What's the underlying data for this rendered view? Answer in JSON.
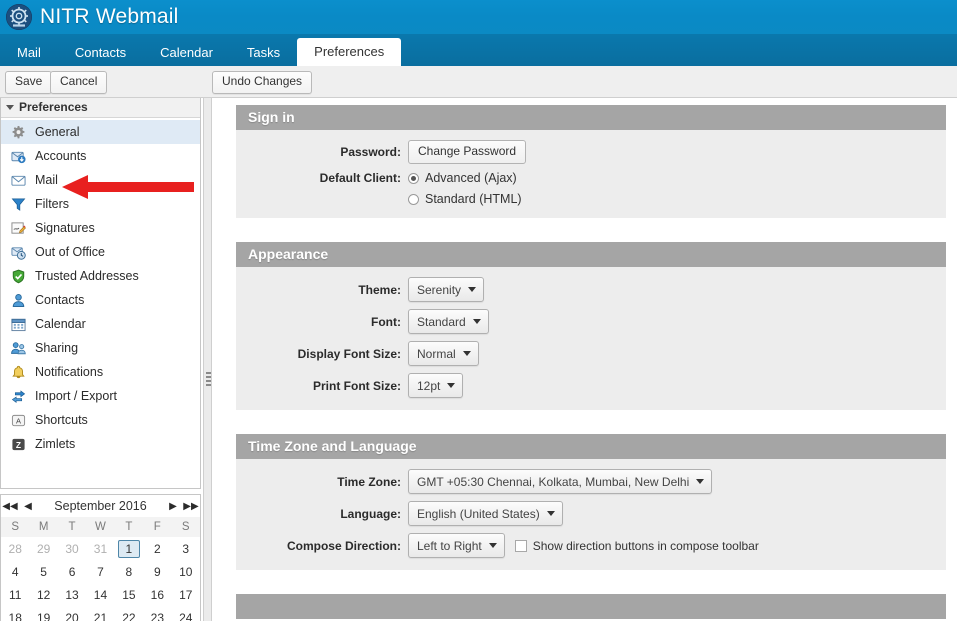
{
  "banner": {
    "title": "NITR Webmail",
    "logo_icon": "gear-emblem-icon"
  },
  "tabs": [
    {
      "label": "Mail",
      "active": false
    },
    {
      "label": "Contacts",
      "active": false
    },
    {
      "label": "Calendar",
      "active": false
    },
    {
      "label": "Tasks",
      "active": false
    },
    {
      "label": "Preferences",
      "active": true
    }
  ],
  "toolbar": {
    "save_label": "Save",
    "cancel_label": "Cancel",
    "undo_label": "Undo Changes"
  },
  "sidebar": {
    "header": "Preferences",
    "items": [
      {
        "label": "General",
        "icon": "gear-icon",
        "selected": true
      },
      {
        "label": "Accounts",
        "icon": "accounts-icon",
        "selected": false
      },
      {
        "label": "Mail",
        "icon": "envelope-icon",
        "selected": false
      },
      {
        "label": "Filters",
        "icon": "filter-funnel-icon",
        "selected": false
      },
      {
        "label": "Signatures",
        "icon": "signature-pencil-icon",
        "selected": false
      },
      {
        "label": "Out of Office",
        "icon": "clock-mail-icon",
        "selected": false
      },
      {
        "label": "Trusted Addresses",
        "icon": "shield-check-icon",
        "selected": false
      },
      {
        "label": "Contacts",
        "icon": "person-icon",
        "selected": false
      },
      {
        "label": "Calendar",
        "icon": "calendar-icon",
        "selected": false
      },
      {
        "label": "Sharing",
        "icon": "people-share-icon",
        "selected": false
      },
      {
        "label": "Notifications",
        "icon": "bell-icon",
        "selected": false
      },
      {
        "label": "Import / Export",
        "icon": "import-export-icon",
        "selected": false
      },
      {
        "label": "Shortcuts",
        "icon": "keyboard-key-icon",
        "selected": false
      },
      {
        "label": "Zimlets",
        "icon": "zimlet-z-icon",
        "selected": false
      }
    ]
  },
  "mini_calendar": {
    "title": "September 2016",
    "nav": {
      "prev_year": "◀◀",
      "prev_month": "◀",
      "next_month": "▶",
      "next_year": "▶▶"
    },
    "weekdays": [
      "S",
      "M",
      "T",
      "W",
      "T",
      "F",
      "S"
    ],
    "weeks": [
      [
        {
          "d": "28",
          "other": true
        },
        {
          "d": "29",
          "other": true
        },
        {
          "d": "30",
          "other": true
        },
        {
          "d": "31",
          "other": true
        },
        {
          "d": "1",
          "today": true
        },
        {
          "d": "2"
        },
        {
          "d": "3"
        }
      ],
      [
        {
          "d": "4"
        },
        {
          "d": "5"
        },
        {
          "d": "6"
        },
        {
          "d": "7"
        },
        {
          "d": "8"
        },
        {
          "d": "9"
        },
        {
          "d": "10"
        }
      ],
      [
        {
          "d": "11"
        },
        {
          "d": "12"
        },
        {
          "d": "13"
        },
        {
          "d": "14"
        },
        {
          "d": "15"
        },
        {
          "d": "16"
        },
        {
          "d": "17"
        }
      ],
      [
        {
          "d": "18"
        },
        {
          "d": "19"
        },
        {
          "d": "20"
        },
        {
          "d": "21"
        },
        {
          "d": "22"
        },
        {
          "d": "23"
        },
        {
          "d": "24"
        }
      ]
    ]
  },
  "sections": {
    "signin": {
      "title": "Sign in",
      "password_label": "Password:",
      "change_password_button": "Change Password",
      "default_client_label": "Default Client:",
      "options": [
        {
          "label": "Advanced (Ajax)",
          "selected": true
        },
        {
          "label": "Standard (HTML)",
          "selected": false
        }
      ]
    },
    "appearance": {
      "title": "Appearance",
      "rows": [
        {
          "label": "Theme:",
          "value": "Serenity"
        },
        {
          "label": "Font:",
          "value": "Standard"
        },
        {
          "label": "Display Font Size:",
          "value": "Normal"
        },
        {
          "label": "Print Font Size:",
          "value": "12pt"
        }
      ]
    },
    "timezone": {
      "title": "Time Zone and Language",
      "timezone_label": "Time Zone:",
      "timezone_value": "GMT +05:30 Chennai, Kolkata, Mumbai, New Delhi",
      "language_label": "Language:",
      "language_value": "English (United States)",
      "compose_direction_label": "Compose Direction:",
      "compose_direction_value": "Left to Right",
      "show_direction_buttons_label": "Show direction buttons in compose toolbar",
      "show_direction_buttons_checked": false
    }
  },
  "annotation": {
    "type": "red-left-arrow",
    "color": "#e8201f",
    "points_to": "Mail"
  },
  "colors": {
    "banner_blue": "#0a8ac6",
    "tabbar_blue": "#0a6e9f",
    "panel_header_gray": "#a5a5a5",
    "panel_body_gray": "#ededed",
    "selection_blue": "#dfeaf5",
    "annotation_red": "#e8201f"
  }
}
